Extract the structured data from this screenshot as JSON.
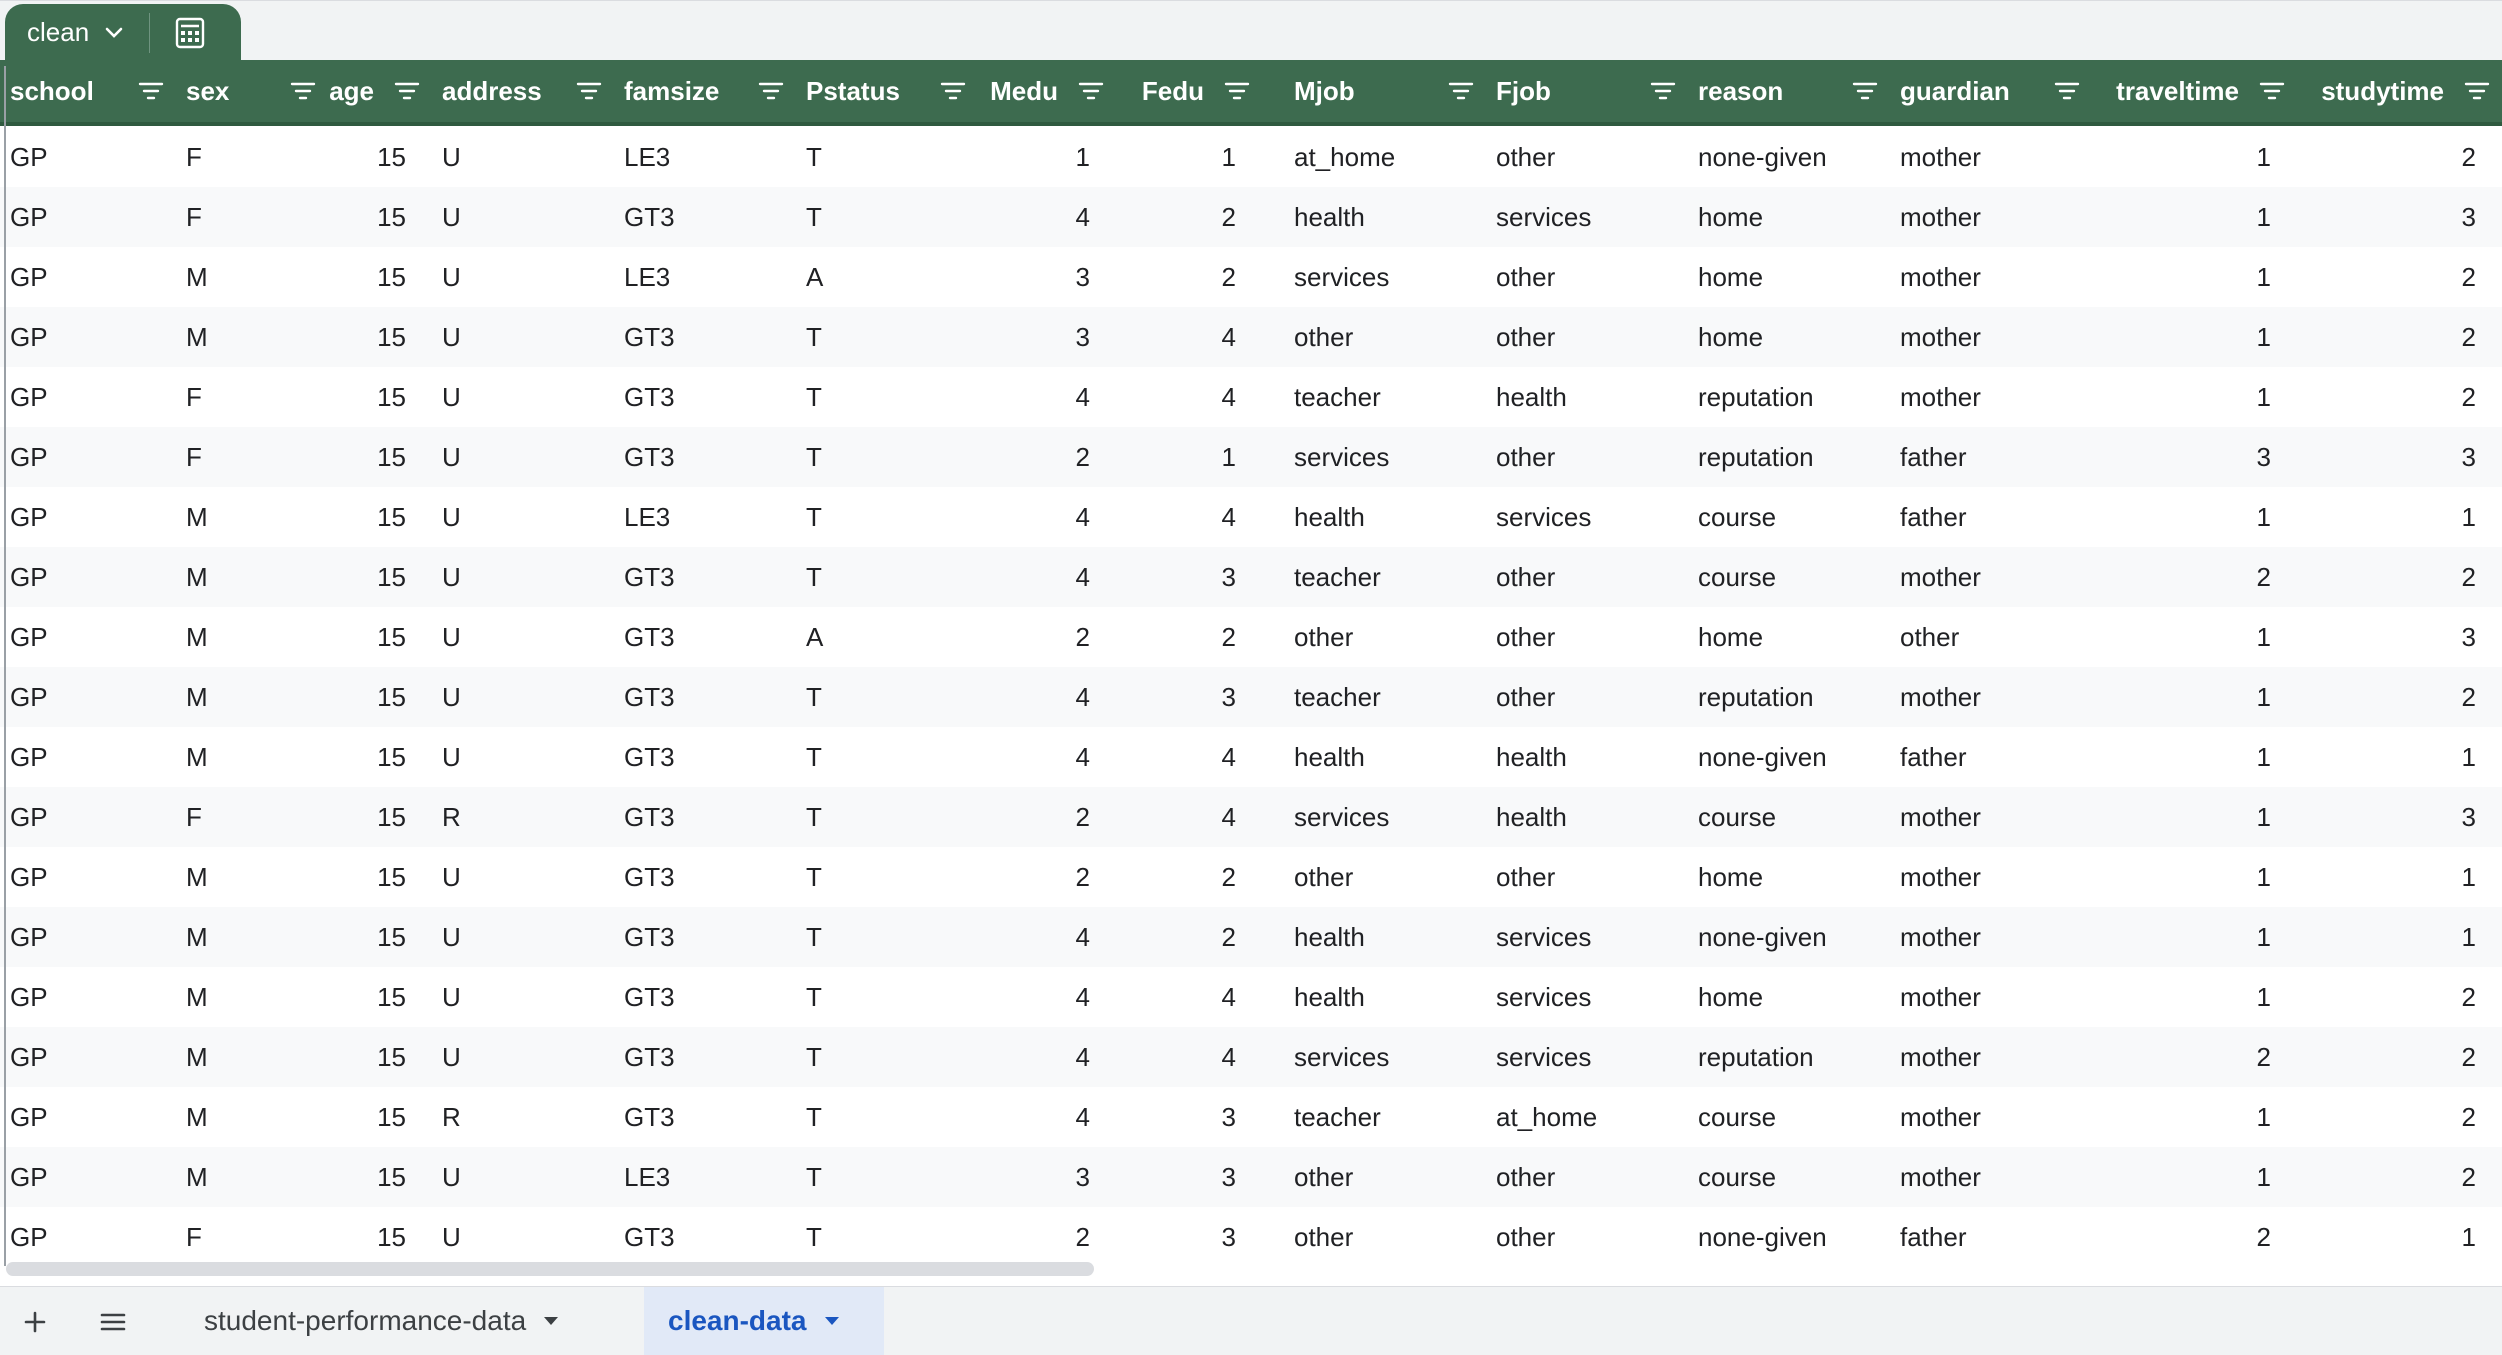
{
  "table_tab": {
    "name": "clean",
    "chevron_icon": "chevron-down-icon",
    "calc_icon": "calculator-icon"
  },
  "columns": [
    {
      "key": "school",
      "label": "school"
    },
    {
      "key": "sex",
      "label": "sex"
    },
    {
      "key": "age",
      "label": "age"
    },
    {
      "key": "address",
      "label": "address"
    },
    {
      "key": "famsize",
      "label": "famsize"
    },
    {
      "key": "Pstatus",
      "label": "Pstatus"
    },
    {
      "key": "Medu",
      "label": "Medu"
    },
    {
      "key": "Fedu",
      "label": "Fedu"
    },
    {
      "key": "Mjob",
      "label": "Mjob"
    },
    {
      "key": "Fjob",
      "label": "Fjob"
    },
    {
      "key": "reason",
      "label": "reason"
    },
    {
      "key": "guardian",
      "label": "guardian"
    },
    {
      "key": "traveltime",
      "label": "traveltime"
    },
    {
      "key": "studytime",
      "label": "studytime"
    }
  ],
  "rows": [
    [
      "GP",
      "F",
      "15",
      "U",
      "LE3",
      "T",
      "1",
      "1",
      "at_home",
      "other",
      "none-given",
      "mother",
      "1",
      "2"
    ],
    [
      "GP",
      "F",
      "15",
      "U",
      "GT3",
      "T",
      "4",
      "2",
      "health",
      "services",
      "home",
      "mother",
      "1",
      "3"
    ],
    [
      "GP",
      "M",
      "15",
      "U",
      "LE3",
      "A",
      "3",
      "2",
      "services",
      "other",
      "home",
      "mother",
      "1",
      "2"
    ],
    [
      "GP",
      "M",
      "15",
      "U",
      "GT3",
      "T",
      "3",
      "4",
      "other",
      "other",
      "home",
      "mother",
      "1",
      "2"
    ],
    [
      "GP",
      "F",
      "15",
      "U",
      "GT3",
      "T",
      "4",
      "4",
      "teacher",
      "health",
      "reputation",
      "mother",
      "1",
      "2"
    ],
    [
      "GP",
      "F",
      "15",
      "U",
      "GT3",
      "T",
      "2",
      "1",
      "services",
      "other",
      "reputation",
      "father",
      "3",
      "3"
    ],
    [
      "GP",
      "M",
      "15",
      "U",
      "LE3",
      "T",
      "4",
      "4",
      "health",
      "services",
      "course",
      "father",
      "1",
      "1"
    ],
    [
      "GP",
      "M",
      "15",
      "U",
      "GT3",
      "T",
      "4",
      "3",
      "teacher",
      "other",
      "course",
      "mother",
      "2",
      "2"
    ],
    [
      "GP",
      "M",
      "15",
      "U",
      "GT3",
      "A",
      "2",
      "2",
      "other",
      "other",
      "home",
      "other",
      "1",
      "3"
    ],
    [
      "GP",
      "M",
      "15",
      "U",
      "GT3",
      "T",
      "4",
      "3",
      "teacher",
      "other",
      "reputation",
      "mother",
      "1",
      "2"
    ],
    [
      "GP",
      "M",
      "15",
      "U",
      "GT3",
      "T",
      "4",
      "4",
      "health",
      "health",
      "none-given",
      "father",
      "1",
      "1"
    ],
    [
      "GP",
      "F",
      "15",
      "R",
      "GT3",
      "T",
      "2",
      "4",
      "services",
      "health",
      "course",
      "mother",
      "1",
      "3"
    ],
    [
      "GP",
      "M",
      "15",
      "U",
      "GT3",
      "T",
      "2",
      "2",
      "other",
      "other",
      "home",
      "mother",
      "1",
      "1"
    ],
    [
      "GP",
      "M",
      "15",
      "U",
      "GT3",
      "T",
      "4",
      "2",
      "health",
      "services",
      "none-given",
      "mother",
      "1",
      "1"
    ],
    [
      "GP",
      "M",
      "15",
      "U",
      "GT3",
      "T",
      "4",
      "4",
      "health",
      "services",
      "home",
      "mother",
      "1",
      "2"
    ],
    [
      "GP",
      "M",
      "15",
      "U",
      "GT3",
      "T",
      "4",
      "4",
      "services",
      "services",
      "reputation",
      "mother",
      "2",
      "2"
    ],
    [
      "GP",
      "M",
      "15",
      "R",
      "GT3",
      "T",
      "4",
      "3",
      "teacher",
      "at_home",
      "course",
      "mother",
      "1",
      "2"
    ],
    [
      "GP",
      "M",
      "15",
      "U",
      "LE3",
      "T",
      "3",
      "3",
      "other",
      "other",
      "course",
      "mother",
      "1",
      "2"
    ],
    [
      "GP",
      "F",
      "15",
      "U",
      "GT3",
      "T",
      "2",
      "3",
      "other",
      "other",
      "none-given",
      "father",
      "2",
      "1"
    ]
  ],
  "bottom_bar": {
    "add_icon": "plus-icon",
    "menu_icon": "hamburger-menu-icon",
    "sheets": [
      {
        "label": "student-performance-data",
        "active": false
      },
      {
        "label": "clean-data",
        "active": true
      }
    ]
  },
  "colors": {
    "header_bg": "#3d6b4f",
    "active_tab_bg": "#e1e9f7",
    "active_tab_text": "#1a56c0",
    "alt_row_bg": "#f8f9fa"
  }
}
